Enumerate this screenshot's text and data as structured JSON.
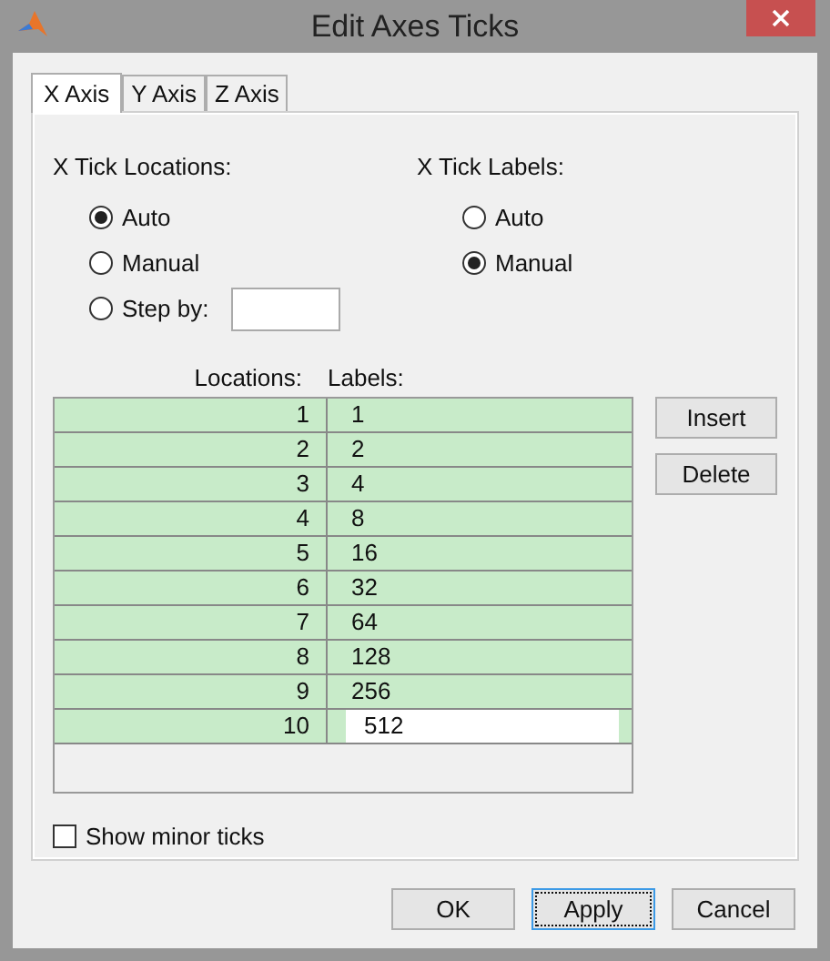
{
  "window": {
    "title": "Edit Axes Ticks"
  },
  "tabs": [
    {
      "label": "X Axis",
      "selected": true
    },
    {
      "label": "Y Axis",
      "selected": false
    },
    {
      "label": "Z Axis",
      "selected": false
    }
  ],
  "locations": {
    "heading": "X Tick Locations:",
    "options": [
      {
        "kind": "radio",
        "label": "Auto",
        "selected": true
      },
      {
        "kind": "radio",
        "label": "Manual",
        "selected": false
      },
      {
        "kind": "step",
        "label": "Step by:",
        "selected": false
      }
    ]
  },
  "labels": {
    "heading": "X Tick Labels:",
    "options": [
      {
        "label": "Auto",
        "selected": false
      },
      {
        "label": "Manual",
        "selected": true
      }
    ]
  },
  "table": {
    "columns": [
      "Locations:",
      "Labels:"
    ],
    "rows": [
      {
        "location": "1",
        "label": "1",
        "editing": false
      },
      {
        "location": "2",
        "label": "2",
        "editing": false
      },
      {
        "location": "3",
        "label": "4",
        "editing": false
      },
      {
        "location": "4",
        "label": "8",
        "editing": false
      },
      {
        "location": "5",
        "label": "16",
        "editing": false
      },
      {
        "location": "6",
        "label": "32",
        "editing": false
      },
      {
        "location": "7",
        "label": "64",
        "editing": false
      },
      {
        "location": "8",
        "label": "128",
        "editing": false
      },
      {
        "location": "9",
        "label": "256",
        "editing": false
      },
      {
        "location": "10",
        "label": "512",
        "editing": true
      }
    ]
  },
  "side_buttons": [
    "Insert",
    "Delete"
  ],
  "minor_ticks": {
    "label": "Show minor ticks",
    "checked": false
  },
  "buttons": [
    {
      "label": "OK",
      "focused": false
    },
    {
      "label": "Apply",
      "focused": true
    },
    {
      "label": "Cancel",
      "focused": false
    }
  ]
}
